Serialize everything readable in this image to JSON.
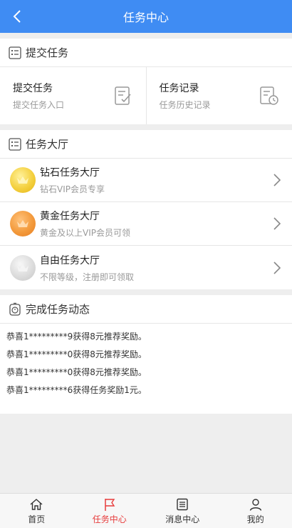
{
  "header": {
    "title": "任务中心",
    "back_icon": "chevron-left-icon"
  },
  "submit_section": {
    "title": "提交任务",
    "cells": [
      {
        "label": "提交任务",
        "sub": "提交任务入口",
        "icon": "edit-document-icon"
      },
      {
        "label": "任务记录",
        "sub": "任务历史记录",
        "icon": "history-document-icon"
      }
    ]
  },
  "hall_section": {
    "title": "任务大厅",
    "items": [
      {
        "label": "钻石任务大厅",
        "sub": "钻石VIP会员专享",
        "medal": "gold-crown-medal"
      },
      {
        "label": "黄金任务大厅",
        "sub": "黄金及以上VIP会员可领",
        "medal": "orange-crown-medal"
      },
      {
        "label": "自由任务大厅",
        "sub": "不限等级，注册即可领取",
        "medal": "silver-crown-medal"
      }
    ]
  },
  "news_section": {
    "title": "完成任务动态",
    "items": [
      "恭喜1*********9获得8元推荐奖励。",
      "恭喜1*********0获得8元推荐奖励。",
      "恭喜1*********0获得8元推荐奖励。",
      "恭喜1*********6获得任务奖励1元。"
    ]
  },
  "tabbar": {
    "tabs": [
      {
        "label": "首页",
        "icon": "home-icon"
      },
      {
        "label": "任务中心",
        "icon": "flag-icon",
        "active": true
      },
      {
        "label": "消息中心",
        "icon": "list-icon"
      },
      {
        "label": "我的",
        "icon": "user-icon"
      }
    ]
  },
  "colors": {
    "primary": "#3f8cf3",
    "active_tab": "#e73c3c",
    "background": "#eeeeee"
  }
}
